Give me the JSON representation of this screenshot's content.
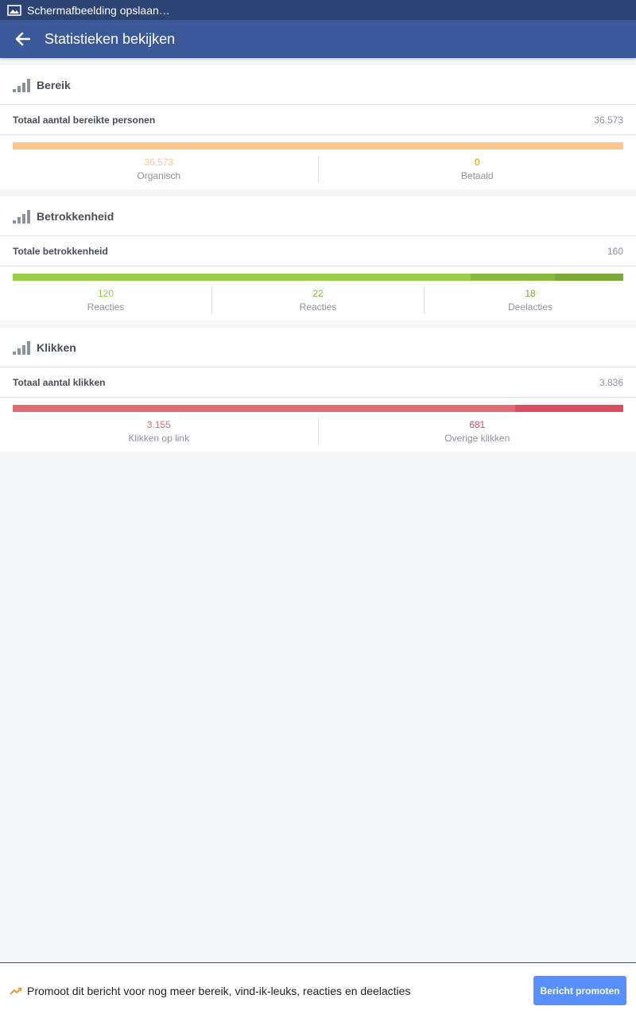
{
  "statusbar": {
    "notification": "Schermafbeelding opslaan…",
    "icon": "image-icon"
  },
  "appbar": {
    "title": "Statistieken bekijken",
    "back_icon": "arrow-left-icon"
  },
  "sections": {
    "reach": {
      "title": "Bereik",
      "icon": "signal-bars-icon",
      "total_label": "Totaal aantal bereikte personen",
      "total_value": "36.573",
      "segments": [
        {
          "value": "36.573",
          "label": "Organisch",
          "color": "#fcc78a",
          "amount": 36573
        },
        {
          "value": "0",
          "label": "Betaald",
          "color": "#e5a200",
          "amount": 0
        }
      ]
    },
    "engagement": {
      "title": "Betrokkenheid",
      "icon": "signal-bars-icon",
      "total_label": "Totale betrokkenheid",
      "total_value": "160",
      "segments": [
        {
          "value": "120",
          "label": "Reacties",
          "color": "#99cc4b",
          "amount": 120
        },
        {
          "value": "22",
          "label": "Reacties",
          "color": "#8bbb3e",
          "amount": 22
        },
        {
          "value": "18",
          "label": "Deelacties",
          "color": "#7da83a",
          "amount": 18
        }
      ]
    },
    "clicks": {
      "title": "Klikken",
      "icon": "signal-bars-icon",
      "total_label": "Totaal aantal klikken",
      "total_value": "3.836",
      "segments": [
        {
          "value": "3.155",
          "label": "Klikken op link",
          "color": "#e06c75",
          "amount": 3155
        },
        {
          "value": "681",
          "label": "Overige klikken",
          "color": "#d9505c",
          "amount": 681
        }
      ]
    }
  },
  "bottom": {
    "icon": "trending-up-icon",
    "promo_text": "Promoot dit bericht voor nog meer bereik, vind-ik-leuks, reacties en deelacties",
    "button_label": "Bericht promoten"
  }
}
